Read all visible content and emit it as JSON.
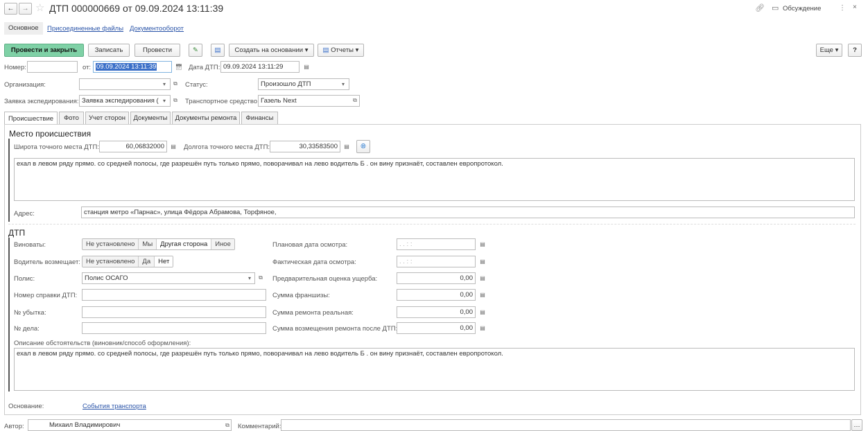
{
  "header": {
    "title": "ДТП 000000669 от 09.09.2024 13:11:39",
    "discussion": "Обсуждение"
  },
  "nav": {
    "main": "Основное",
    "files": "Присоединенные файлы",
    "docflow": "Документооборот"
  },
  "toolbar": {
    "post_close": "Провести и закрыть",
    "save": "Записать",
    "post": "Провести",
    "create_based": "Создать на основании",
    "reports": "Отчеты",
    "more": "Еще",
    "help": "?"
  },
  "form": {
    "number_label": "Номер:",
    "number": "",
    "from_label": "от:",
    "date": "09.09.2024 13:11:39",
    "accident_date_label": "Дата ДТП:",
    "accident_date": "09.09.2024 13:11:29",
    "org_label": "Организация:",
    "org": "",
    "status_label": "Статус:",
    "status": "Произошло ДТП",
    "request_label": "Заявка экспедирования:",
    "request": "Заявка экспедирования (",
    "vehicle_label": "Транспортное средство:",
    "vehicle": "Газель Next"
  },
  "tabs": [
    "Происшествие",
    "Фото",
    "Учет сторон",
    "Документы",
    "Документы ремонта",
    "Финансы"
  ],
  "place": {
    "title": "Место происшествия",
    "lat_label": "Широта точного места ДТП:",
    "lat": "60,06832000",
    "lon_label": "Долгота точного места ДТП:",
    "lon": "30,33583500",
    "description": "ехал в левом ряду прямо. со средней полосы, где разрешён путь только прямо, поворачивал на лево водитель Б . он вину признаёт, составлен европротокол.",
    "address_label": "Адрес:",
    "address": "станция метро «Парнас», улица Фёдора Абрамова, Торфяное,"
  },
  "dtp": {
    "title": "ДТП",
    "guilty_label": "Виноваты:",
    "guilty_options": [
      "Не установлено",
      "Мы",
      "Другая сторона",
      "Иное"
    ],
    "guilty_selected": 2,
    "driver_label": "Водитель возмещает:",
    "driver_options": [
      "Не установлено",
      "Да",
      "Нет"
    ],
    "driver_selected": 2,
    "policy_label": "Полис:",
    "policy": "Полис ОСАГО",
    "cert_label": "Номер справки ДТП:",
    "cert": "",
    "loss_label": "№ убытка:",
    "loss": "",
    "case_label": "№ дела:",
    "case": "",
    "plan_date_label": "Плановая дата осмотра:",
    "plan_date": ".  .     :  :",
    "fact_date_label": "Фактическая дата осмотра:",
    "fact_date": ".  .     :  :",
    "estimate_label": "Предварительная оценка ущерба:",
    "estimate": "0,00",
    "franchise_label": "Сумма франшизы:",
    "franchise": "0,00",
    "repair_label": "Сумма ремонта реальная:",
    "repair": "0,00",
    "compensation_label": "Сумма возмещения ремонта после ДТП:",
    "compensation": "0,00",
    "circ_label": "Описание обстоятельств (виновник/способ оформления):",
    "circ": "ехал в левом ряду прямо. со средней полосы, где разрешён путь только прямо, поворачивал на лево водитель Б . он вину признаёт, составлен европротокол."
  },
  "footer": {
    "basis_label": "Основание:",
    "basis": "События транспорта",
    "author_label": "Автор:",
    "author": "Михаил Владимирович",
    "comment_label": "Комментарий:"
  },
  "colors": {
    "primary": "#7fd1a6",
    "selection": "#3a6fc8",
    "link": "#2a54a8"
  }
}
